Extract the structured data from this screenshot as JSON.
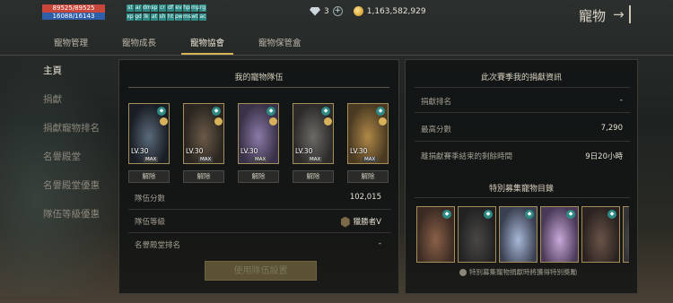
{
  "topbar": {
    "hp_text": "89525/89525",
    "mp_text": "16088/16143",
    "buff_icons": [
      "st",
      "ar",
      "dm",
      "sp",
      "cr",
      "df",
      "ev",
      "hp",
      "mp",
      "rg",
      "xp",
      "gd",
      "lk",
      "at",
      "sh",
      "ht",
      "pw",
      "ms",
      "wt",
      "ac"
    ],
    "gem_count": "3",
    "plus_symbol": "+",
    "gold": "1,163,582,929",
    "page_title": "寵物",
    "exit_symbol": "→"
  },
  "tabs": [
    {
      "label": "寵物管理",
      "active": false
    },
    {
      "label": "寵物成長",
      "active": false
    },
    {
      "label": "寵物協會",
      "active": true
    },
    {
      "label": "寵物保管盒",
      "active": false
    }
  ],
  "sidebar": {
    "items": [
      {
        "label": "主頁",
        "active": true
      },
      {
        "label": "捐獻",
        "active": false
      },
      {
        "label": "捐獻寵物排名",
        "active": false
      },
      {
        "label": "名譽殿堂",
        "active": false
      },
      {
        "label": "名譽殿堂優惠",
        "active": false
      },
      {
        "label": "隊伍等級優惠",
        "active": false
      }
    ]
  },
  "team": {
    "title": "我的寵物隊伍",
    "pets": [
      {
        "level": "LV.30",
        "max": "MAX",
        "release": "解除",
        "colors": [
          "#5a6a7a",
          "#1a1d24"
        ]
      },
      {
        "level": "LV.30",
        "max": "MAX",
        "release": "解除",
        "colors": [
          "#6a5a48",
          "#2a2520"
        ]
      },
      {
        "level": "LV.30",
        "max": "MAX",
        "release": "解除",
        "colors": [
          "#8a7aa8",
          "#3a3248"
        ]
      },
      {
        "level": "LV.30",
        "max": "MAX",
        "release": "解除",
        "colors": [
          "#6c6a66",
          "#2c2b29"
        ]
      },
      {
        "level": "LV.30",
        "max": "MAX",
        "release": "解除",
        "colors": [
          "#b08848",
          "#4a3a22"
        ]
      }
    ],
    "stats": {
      "score_label": "隊伍分數",
      "score_value": "102,015",
      "level_label": "隊伍等級",
      "level_value": "獵勝者V",
      "hall_label": "名譽殿堂排名",
      "hall_value": "-"
    },
    "use_button": "使用隊伍設置"
  },
  "season": {
    "title": "此次賽季我的捐獻資訊",
    "rank_label": "捐獻排名",
    "rank_value": "-",
    "best_label": "最高分數",
    "best_value": "7,290",
    "remain_label": "離捐獻賽季結束的剩餘時間",
    "remain_value": "9日20小時"
  },
  "special": {
    "title": "特別募集寵物目錄",
    "pets": [
      {
        "colors": [
          "#8a6048",
          "#3a2a22"
        ]
      },
      {
        "colors": [
          "#4a4846",
          "#222"
        ]
      },
      {
        "colors": [
          "#a8b8d8",
          "#3a4050"
        ]
      },
      {
        "colors": [
          "#c8a8d8",
          "#4a3a58"
        ]
      },
      {
        "colors": [
          "#6a5448",
          "#2a2220"
        ]
      },
      {
        "colors": [
          "#7a7a7a",
          "#333"
        ]
      }
    ],
    "note": "特別募集寵物捐獻時將獲得特別獎勵"
  }
}
